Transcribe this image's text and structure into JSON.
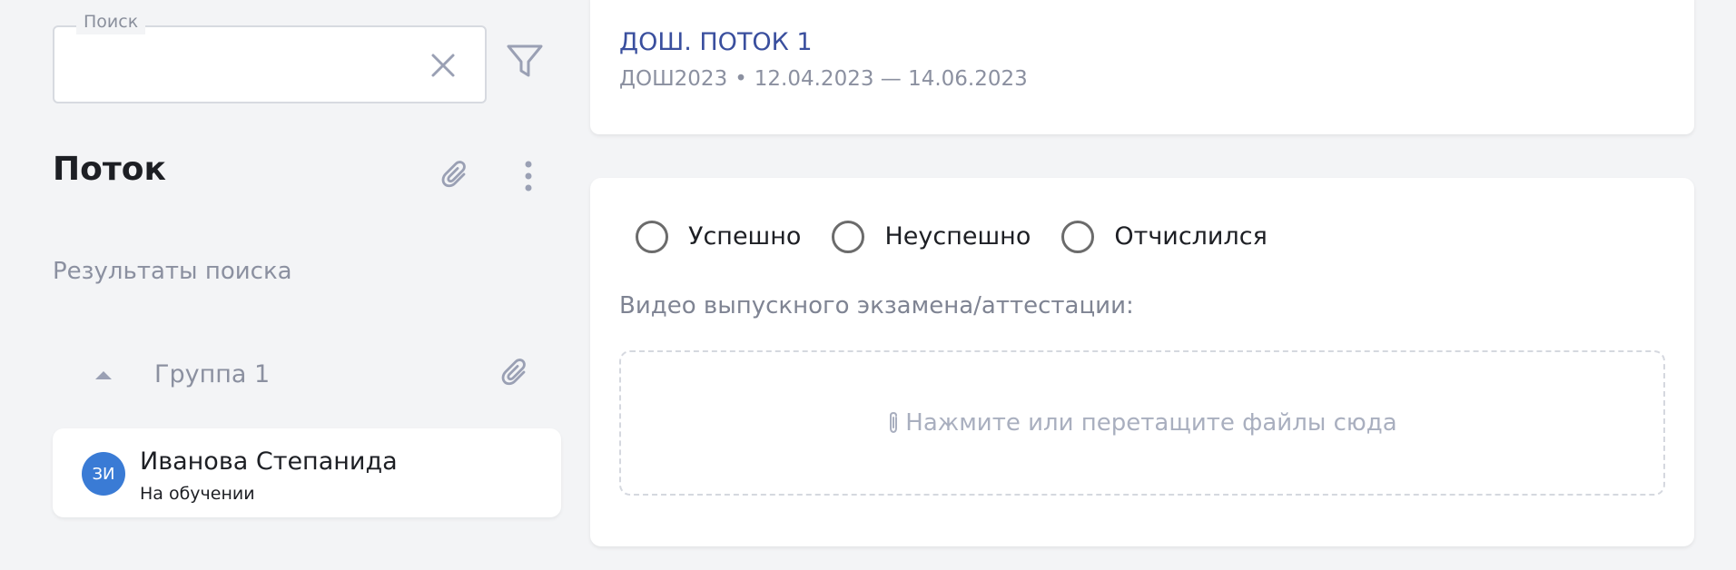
{
  "search": {
    "legend": "Поиск",
    "value": "",
    "placeholder": ""
  },
  "sidebar": {
    "title": "Поток",
    "results_label": "Результаты поиска",
    "group": {
      "label": "Группа 1",
      "expanded": true
    },
    "students": [
      {
        "initials": "ЗИ",
        "name": "Иванова Степанида",
        "status": "На обучении",
        "avatar_color": "#3a7bd5"
      }
    ]
  },
  "stream": {
    "title": "ДОШ. ПОТОК 1",
    "code": "ДОШ2023",
    "separator": "•",
    "date_range": "12.04.2023 — 14.06.2023"
  },
  "result": {
    "options": [
      {
        "label": "Успешно",
        "selected": false
      },
      {
        "label": "Неуспешно",
        "selected": false
      },
      {
        "label": "Отчислился",
        "selected": false
      }
    ],
    "video_label": "Видео выпускного экзамена/аттестации:",
    "dropzone_text": "Нажмите или перетащите файлы сюда"
  },
  "icons": {
    "clear": "close-icon",
    "filter": "filter-icon",
    "attach": "paperclip-icon",
    "more": "more-vertical-icon",
    "collapse": "caret-up-icon"
  },
  "colors": {
    "background": "#f3f4f6",
    "link": "#3a4f9e",
    "muted_text": "#8b90a0",
    "icon": "#9aa0b4",
    "avatar": "#3a7bd5"
  }
}
